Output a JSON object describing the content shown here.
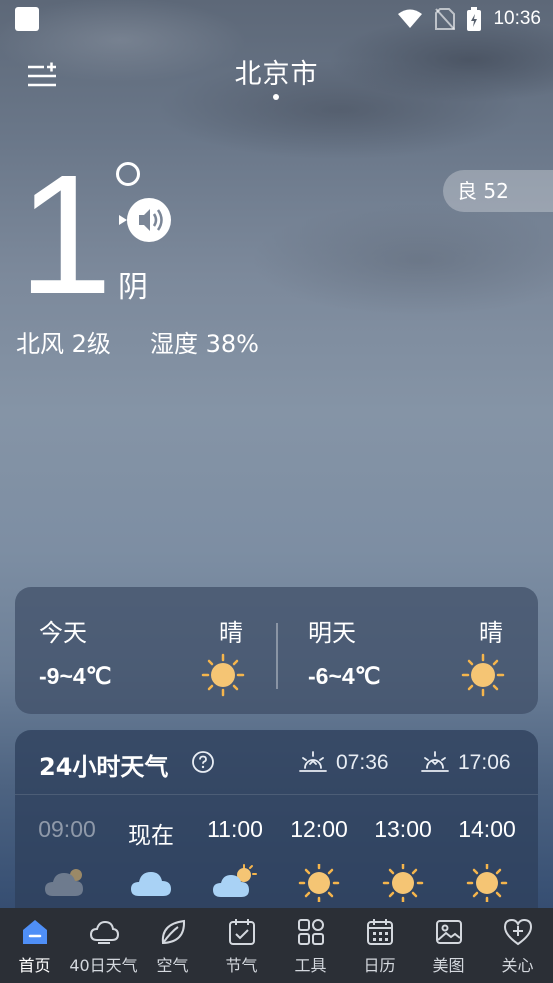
{
  "status_bar": {
    "time": "10:36"
  },
  "header": {
    "city": "北京市"
  },
  "current": {
    "temperature": "1",
    "condition": "阴",
    "aqi": "良 52",
    "wind": "北风 2级",
    "humidity": "湿度 38%"
  },
  "forecast": [
    {
      "day": "今天",
      "condition": "晴",
      "range": "-9~4℃",
      "icon": "sun-icon"
    },
    {
      "day": "明天",
      "condition": "晴",
      "range": "-6~4℃",
      "icon": "sun-icon"
    }
  ],
  "hourly": {
    "title": "24小时天气",
    "sunrise": "07:36",
    "sunset": "17:06",
    "hours": [
      {
        "time": "09:00",
        "icon": "cloudy-dark-icon"
      },
      {
        "time": "现在",
        "icon": "cloud-icon"
      },
      {
        "time": "11:00",
        "icon": "partly-cloudy-icon"
      },
      {
        "time": "12:00",
        "icon": "sun-icon"
      },
      {
        "time": "13:00",
        "icon": "sun-icon"
      },
      {
        "time": "14:00",
        "icon": "sun-icon"
      }
    ]
  },
  "nav": {
    "items": [
      {
        "label": "首页",
        "icon": "home-icon",
        "active": true
      },
      {
        "label": "40日天气",
        "icon": "cloud-outline-icon"
      },
      {
        "label": "空气",
        "icon": "leaf-icon"
      },
      {
        "label": "节气",
        "icon": "calendar-check-icon"
      },
      {
        "label": "工具",
        "icon": "grid-icon"
      },
      {
        "label": "日历",
        "icon": "calendar-icon"
      },
      {
        "label": "美图",
        "icon": "image-icon"
      },
      {
        "label": "关心",
        "icon": "heart-plus-icon"
      }
    ]
  },
  "colors": {
    "sun": "#f5c574",
    "nav_bg": "#2b2f36",
    "active": "#4f8ff7"
  }
}
